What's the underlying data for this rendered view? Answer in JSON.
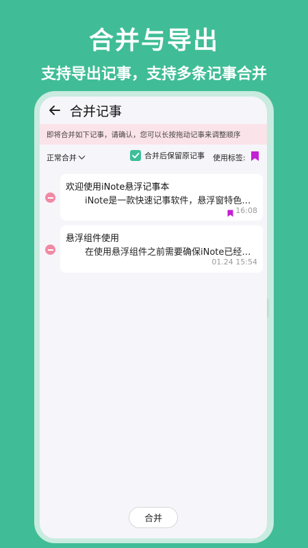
{
  "promo": {
    "title": "合并与导出",
    "subtitle": "支持导出记事，支持多条记事合并"
  },
  "header": {
    "title": "合并记事"
  },
  "notice": "即将合并如下记事，请确认，您可以长按拖动记事来调整顺序",
  "options": {
    "merge_mode": "正常合并",
    "keep_original_label": "合并后保留原记事",
    "keep_original_checked": true,
    "use_tag_label": "使用标签:"
  },
  "notes": [
    {
      "title": "欢迎使用iNote悬浮记事本",
      "body": "iNote是一款快速记事软件，悬浮窗特色功能...",
      "time": "16:08",
      "has_tag": true
    },
    {
      "title": "悬浮组件使用",
      "body": "在使用悬浮组件之前需要确保iNote已经获取悬浮窗权限",
      "time": "01.24 15:54",
      "has_tag": false
    }
  ],
  "actions": {
    "merge_label": "合并"
  },
  "colors": {
    "background": "#40bd96",
    "accent": "#3cbf98",
    "tag": "#c41fd4",
    "remove": "#f08aa4",
    "notice_bg": "#fbe3ea"
  },
  "icons": {
    "back": "arrow-left-icon",
    "chevron": "chevron-down-icon",
    "check": "check-icon",
    "tag": "bookmark-icon",
    "remove": "minus-circle-icon"
  }
}
